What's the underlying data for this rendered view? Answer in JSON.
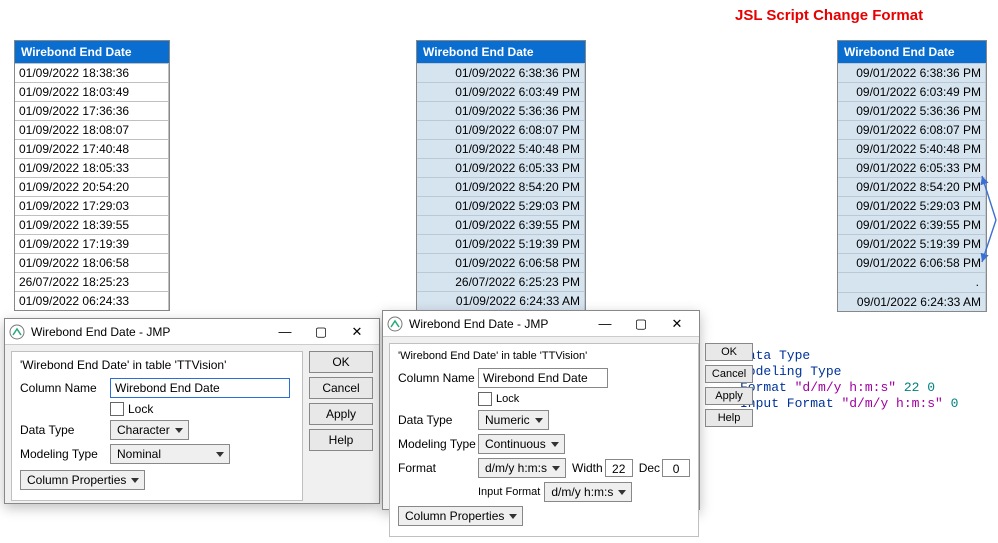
{
  "table1": {
    "header": "Wirebond End Date",
    "rows": [
      "01/09/2022 18:38:36",
      "01/09/2022 18:03:49",
      "01/09/2022 17:36:36",
      "01/09/2022 18:08:07",
      "01/09/2022 17:40:48",
      "01/09/2022 18:05:33",
      "01/09/2022 20:54:20",
      "01/09/2022 17:29:03",
      "01/09/2022 18:39:55",
      "01/09/2022 17:19:39",
      "01/09/2022 18:06:58",
      "26/07/2022 18:25:23",
      "01/09/2022 06:24:33"
    ]
  },
  "table2": {
    "header": "Wirebond End Date",
    "rows": [
      "01/09/2022 6:38:36 PM",
      "01/09/2022 6:03:49 PM",
      "01/09/2022 5:36:36 PM",
      "01/09/2022 6:08:07 PM",
      "01/09/2022 5:40:48 PM",
      "01/09/2022 6:05:33 PM",
      "01/09/2022 8:54:20 PM",
      "01/09/2022 5:29:03 PM",
      "01/09/2022 6:39:55 PM",
      "01/09/2022 5:19:39 PM",
      "01/09/2022 6:06:58 PM",
      "26/07/2022 6:25:23 PM",
      "01/09/2022 6:24:33 AM"
    ]
  },
  "table3": {
    "header": "Wirebond End Date",
    "rows": [
      "09/01/2022 6:38:36 PM",
      "09/01/2022 6:03:49 PM",
      "09/01/2022 5:36:36 PM",
      "09/01/2022 6:08:07 PM",
      "09/01/2022 5:40:48 PM",
      "09/01/2022 6:05:33 PM",
      "09/01/2022 8:54:20 PM",
      "09/01/2022 5:29:03 PM",
      "09/01/2022 6:39:55 PM",
      "09/01/2022 5:19:39 PM",
      "09/01/2022 6:06:58 PM",
      "",
      "09/01/2022 6:24:33 AM"
    ]
  },
  "red_title": "JSL Script Change Format",
  "dialog1": {
    "title": "Wirebond End Date - JMP",
    "subtitle": "'Wirebond End Date' in table 'TTVision'",
    "labels": {
      "column_name": "Column Name",
      "lock": "Lock",
      "data_type": "Data Type",
      "modeling_type": "Modeling Type",
      "column_properties": "Column Properties"
    },
    "values": {
      "column_name": "Wirebond End Date",
      "data_type": "Character",
      "modeling_type": "Nominal"
    },
    "buttons": {
      "ok": "OK",
      "cancel": "Cancel",
      "apply": "Apply",
      "help": "Help"
    }
  },
  "dialog2": {
    "title": "Wirebond End Date - JMP",
    "subtitle": "'Wirebond End Date' in table 'TTVision'",
    "labels": {
      "column_name": "Column Name",
      "lock": "Lock",
      "data_type": "Data Type",
      "modeling_type": "Modeling Type",
      "format": "Format",
      "width": "Width",
      "dec": "Dec",
      "input_format": "Input Format",
      "column_properties": "Column Properties"
    },
    "values": {
      "column_name": "Wirebond End Date",
      "data_type": "Numeric",
      "modeling_type": "Continuous",
      "format": "d/m/y h:m:s",
      "width": "22",
      "dec": "0",
      "input_format": "d/m/y h:m:s"
    },
    "buttons": {
      "ok": "OK",
      "cancel": "Cancel",
      "apply": "Apply",
      "help": "Help"
    }
  },
  "code": {
    "l1a": "Data Type",
    "l2a": "Modeling Type",
    "l3a": "Format",
    "l3b": "\"d/m/y h:m:s\"",
    "l3c": "22",
    "l3d": "0",
    "l4a": "Input Format",
    "l4b": "\"d/m/y h:m:s\"",
    "l4c": "0"
  }
}
